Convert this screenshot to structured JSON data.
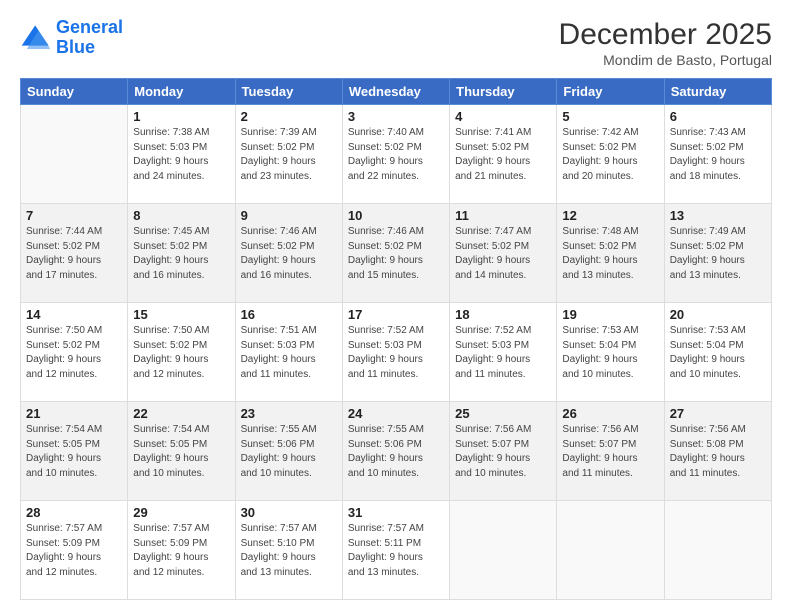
{
  "header": {
    "logo_line1": "General",
    "logo_line2": "Blue",
    "month": "December 2025",
    "location": "Mondim de Basto, Portugal"
  },
  "weekdays": [
    "Sunday",
    "Monday",
    "Tuesday",
    "Wednesday",
    "Thursday",
    "Friday",
    "Saturday"
  ],
  "weeks": [
    [
      {
        "day": "",
        "info": ""
      },
      {
        "day": "1",
        "info": "Sunrise: 7:38 AM\nSunset: 5:03 PM\nDaylight: 9 hours\nand 24 minutes."
      },
      {
        "day": "2",
        "info": "Sunrise: 7:39 AM\nSunset: 5:02 PM\nDaylight: 9 hours\nand 23 minutes."
      },
      {
        "day": "3",
        "info": "Sunrise: 7:40 AM\nSunset: 5:02 PM\nDaylight: 9 hours\nand 22 minutes."
      },
      {
        "day": "4",
        "info": "Sunrise: 7:41 AM\nSunset: 5:02 PM\nDaylight: 9 hours\nand 21 minutes."
      },
      {
        "day": "5",
        "info": "Sunrise: 7:42 AM\nSunset: 5:02 PM\nDaylight: 9 hours\nand 20 minutes."
      },
      {
        "day": "6",
        "info": "Sunrise: 7:43 AM\nSunset: 5:02 PM\nDaylight: 9 hours\nand 18 minutes."
      }
    ],
    [
      {
        "day": "7",
        "info": "Sunrise: 7:44 AM\nSunset: 5:02 PM\nDaylight: 9 hours\nand 17 minutes."
      },
      {
        "day": "8",
        "info": "Sunrise: 7:45 AM\nSunset: 5:02 PM\nDaylight: 9 hours\nand 16 minutes."
      },
      {
        "day": "9",
        "info": "Sunrise: 7:46 AM\nSunset: 5:02 PM\nDaylight: 9 hours\nand 16 minutes."
      },
      {
        "day": "10",
        "info": "Sunrise: 7:46 AM\nSunset: 5:02 PM\nDaylight: 9 hours\nand 15 minutes."
      },
      {
        "day": "11",
        "info": "Sunrise: 7:47 AM\nSunset: 5:02 PM\nDaylight: 9 hours\nand 14 minutes."
      },
      {
        "day": "12",
        "info": "Sunrise: 7:48 AM\nSunset: 5:02 PM\nDaylight: 9 hours\nand 13 minutes."
      },
      {
        "day": "13",
        "info": "Sunrise: 7:49 AM\nSunset: 5:02 PM\nDaylight: 9 hours\nand 13 minutes."
      }
    ],
    [
      {
        "day": "14",
        "info": "Sunrise: 7:50 AM\nSunset: 5:02 PM\nDaylight: 9 hours\nand 12 minutes."
      },
      {
        "day": "15",
        "info": "Sunrise: 7:50 AM\nSunset: 5:02 PM\nDaylight: 9 hours\nand 12 minutes."
      },
      {
        "day": "16",
        "info": "Sunrise: 7:51 AM\nSunset: 5:03 PM\nDaylight: 9 hours\nand 11 minutes."
      },
      {
        "day": "17",
        "info": "Sunrise: 7:52 AM\nSunset: 5:03 PM\nDaylight: 9 hours\nand 11 minutes."
      },
      {
        "day": "18",
        "info": "Sunrise: 7:52 AM\nSunset: 5:03 PM\nDaylight: 9 hours\nand 11 minutes."
      },
      {
        "day": "19",
        "info": "Sunrise: 7:53 AM\nSunset: 5:04 PM\nDaylight: 9 hours\nand 10 minutes."
      },
      {
        "day": "20",
        "info": "Sunrise: 7:53 AM\nSunset: 5:04 PM\nDaylight: 9 hours\nand 10 minutes."
      }
    ],
    [
      {
        "day": "21",
        "info": "Sunrise: 7:54 AM\nSunset: 5:05 PM\nDaylight: 9 hours\nand 10 minutes."
      },
      {
        "day": "22",
        "info": "Sunrise: 7:54 AM\nSunset: 5:05 PM\nDaylight: 9 hours\nand 10 minutes."
      },
      {
        "day": "23",
        "info": "Sunrise: 7:55 AM\nSunset: 5:06 PM\nDaylight: 9 hours\nand 10 minutes."
      },
      {
        "day": "24",
        "info": "Sunrise: 7:55 AM\nSunset: 5:06 PM\nDaylight: 9 hours\nand 10 minutes."
      },
      {
        "day": "25",
        "info": "Sunrise: 7:56 AM\nSunset: 5:07 PM\nDaylight: 9 hours\nand 10 minutes."
      },
      {
        "day": "26",
        "info": "Sunrise: 7:56 AM\nSunset: 5:07 PM\nDaylight: 9 hours\nand 11 minutes."
      },
      {
        "day": "27",
        "info": "Sunrise: 7:56 AM\nSunset: 5:08 PM\nDaylight: 9 hours\nand 11 minutes."
      }
    ],
    [
      {
        "day": "28",
        "info": "Sunrise: 7:57 AM\nSunset: 5:09 PM\nDaylight: 9 hours\nand 12 minutes."
      },
      {
        "day": "29",
        "info": "Sunrise: 7:57 AM\nSunset: 5:09 PM\nDaylight: 9 hours\nand 12 minutes."
      },
      {
        "day": "30",
        "info": "Sunrise: 7:57 AM\nSunset: 5:10 PM\nDaylight: 9 hours\nand 13 minutes."
      },
      {
        "day": "31",
        "info": "Sunrise: 7:57 AM\nSunset: 5:11 PM\nDaylight: 9 hours\nand 13 minutes."
      },
      {
        "day": "",
        "info": ""
      },
      {
        "day": "",
        "info": ""
      },
      {
        "day": "",
        "info": ""
      }
    ]
  ]
}
